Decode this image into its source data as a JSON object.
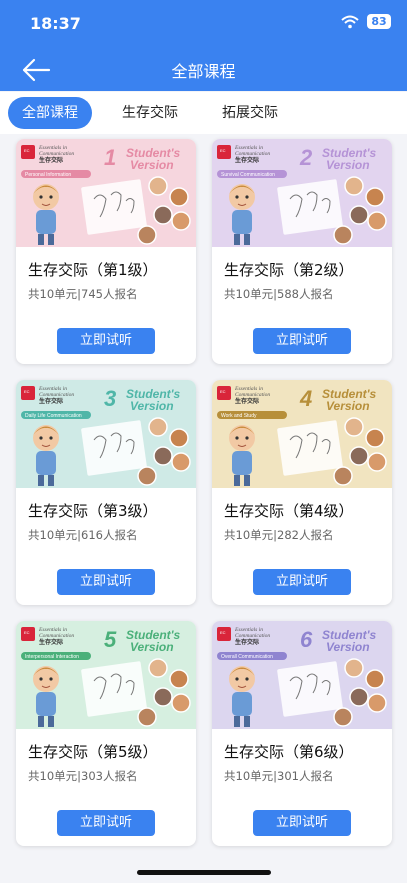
{
  "status": {
    "time": "18:37",
    "battery": "83"
  },
  "header": {
    "title": "全部课程"
  },
  "tabs": [
    {
      "label": "全部课程"
    },
    {
      "label": "生存交际"
    },
    {
      "label": "拓展交际"
    }
  ],
  "courses": [
    {
      "title": "生存交际（第1级）",
      "meta": "共10单元|745人报名",
      "button": "立即试听",
      "cover": {
        "bg": "#f6d6de",
        "banner": "#e58aa4",
        "number": "1",
        "topic": "Personal Information",
        "series_en1": "Essentials in",
        "series_en2": "Communication",
        "series_cn": "生存交际",
        "version1": "Student's",
        "version2": "Version"
      }
    },
    {
      "title": "生存交际（第2级）",
      "meta": "共10单元|588人报名",
      "button": "立即试听",
      "cover": {
        "bg": "#e2d4ef",
        "banner": "#b593d6",
        "number": "2",
        "topic": "Survival Communication",
        "series_en1": "Essentials in",
        "series_en2": "Communication",
        "series_cn": "生存交际",
        "version1": "Student's",
        "version2": "Version"
      }
    },
    {
      "title": "生存交际（第3级）",
      "meta": "共10单元|616人报名",
      "button": "立即试听",
      "cover": {
        "bg": "#cfeae6",
        "banner": "#4fb6a8",
        "number": "3",
        "topic": "Daily Life Communication",
        "series_en1": "Essentials in",
        "series_en2": "Communication",
        "series_cn": "生存交际",
        "version1": "Student's",
        "version2": "Version"
      }
    },
    {
      "title": "生存交际（第4级）",
      "meta": "共10单元|282人报名",
      "button": "立即试听",
      "cover": {
        "bg": "#f1e4c0",
        "banner": "#b78f3a",
        "number": "4",
        "topic": "Work and Study",
        "series_en1": "Essentials in",
        "series_en2": "Communication",
        "series_cn": "生存交际",
        "version1": "Student's",
        "version2": "Version"
      }
    },
    {
      "title": "生存交际（第5级）",
      "meta": "共10单元|303人报名",
      "button": "立即试听",
      "cover": {
        "bg": "#d6efe0",
        "banner": "#4bb07a",
        "number": "5",
        "topic": "Interpersonal Interaction",
        "series_en1": "Essentials in",
        "series_en2": "Communication",
        "series_cn": "生存交际",
        "version1": "Student's",
        "version2": "Version"
      }
    },
    {
      "title": "生存交际（第6级）",
      "meta": "共10单元|301人报名",
      "button": "立即试听",
      "cover": {
        "bg": "#dcd6ef",
        "banner": "#8f84d0",
        "number": "6",
        "topic": "Overall Communication",
        "series_en1": "Essentials in",
        "series_en2": "Communication",
        "series_cn": "生存交际",
        "version1": "Student's",
        "version2": "Version"
      }
    }
  ],
  "colors": {
    "accent": "#3a82f0",
    "cover_red": "#d9253a"
  }
}
